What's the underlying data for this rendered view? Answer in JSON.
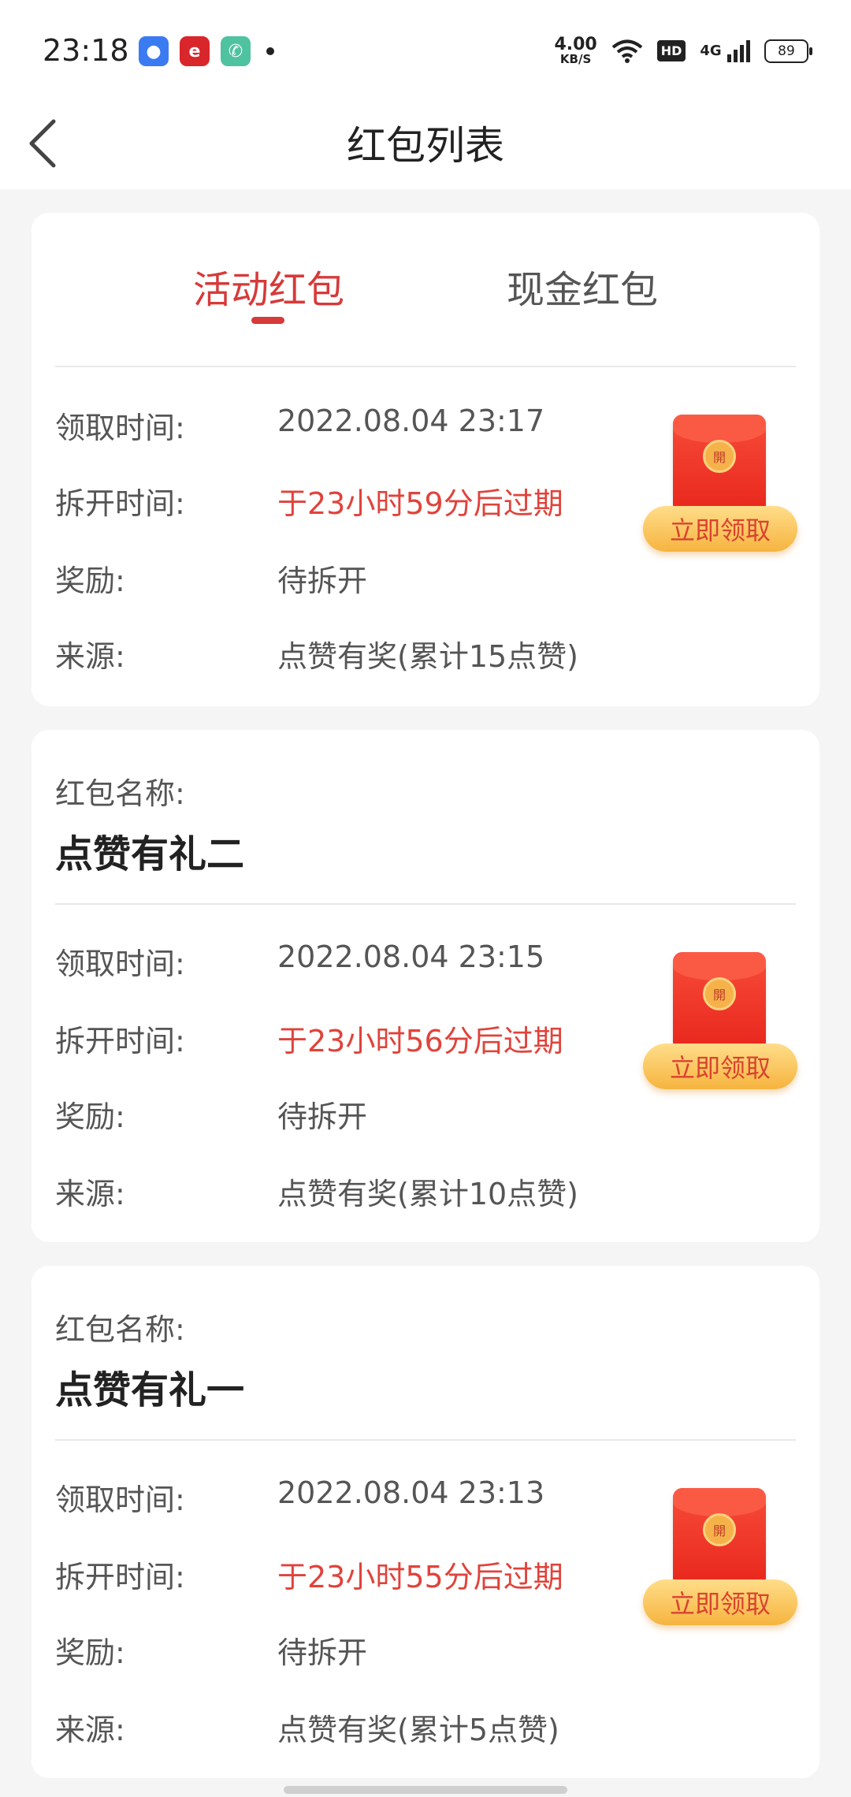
{
  "status_bar": {
    "time": "23:18",
    "net_speed_value": "4.00",
    "net_speed_unit": "KB/S",
    "hd": "HD",
    "signal": "4G",
    "battery": "89",
    "app_icons": [
      "chat-app-icon",
      "news-app-icon",
      "phone-app-icon"
    ]
  },
  "nav": {
    "title": "红包列表",
    "back_icon": "chevron-left-icon"
  },
  "tabs": [
    {
      "label": "活动红包",
      "active": true
    },
    {
      "label": "现金红包",
      "active": false
    }
  ],
  "labels": {
    "name": "红包名称:",
    "receive_time": "领取时间:",
    "open_time": "拆开时间:",
    "reward": "奖励:",
    "source": "来源:",
    "claim_button": "立即领取",
    "seal_char": "開"
  },
  "packets": [
    {
      "name": "",
      "receive_time": "2022.08.04 23:17",
      "open_time": "于23小时59分后过期",
      "reward": "待拆开",
      "source": "点赞有奖(累计15点赞)"
    },
    {
      "name": "点赞有礼二",
      "receive_time": "2022.08.04 23:15",
      "open_time": "于23小时56分后过期",
      "reward": "待拆开",
      "source": "点赞有奖(累计10点赞)"
    },
    {
      "name": "点赞有礼一",
      "receive_time": "2022.08.04 23:13",
      "open_time": "于23小时55分后过期",
      "reward": "待拆开",
      "source": "点赞有奖(累计5点赞)"
    }
  ],
  "colors": {
    "accent_red": "#d63a3a",
    "expiry_red": "#e0433b",
    "claim_button_gold": "#f6b43f"
  }
}
